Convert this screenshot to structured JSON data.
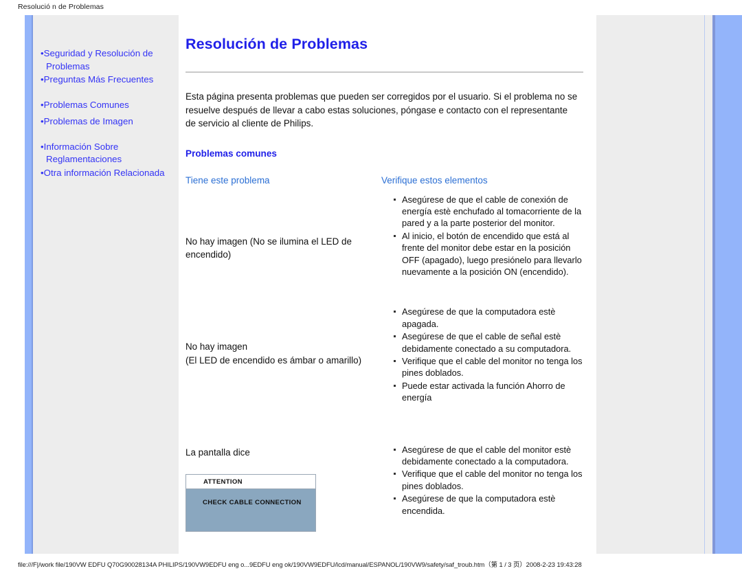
{
  "print_header": "Resolució n de Problemas",
  "sidebar": {
    "groups": [
      {
        "items": [
          {
            "label": "Seguridad y Resolución de Problemas"
          },
          {
            "label": "Preguntas Más Frecuentes"
          }
        ]
      },
      {
        "items": [
          {
            "label": "Problemas Comunes"
          },
          {
            "label": "Problemas de Imagen"
          }
        ]
      },
      {
        "items": [
          {
            "label": "Información Sobre Reglamentaciones"
          },
          {
            "label": "Otra información Relacionada"
          }
        ]
      }
    ]
  },
  "main": {
    "title": "Resolución de Problemas",
    "intro": "Esta página presenta problemas que pueden ser corregidos por el usuario. Si el problema no se resuelve después de llevar a cabo estas soluciones, póngase e contacto con el representante de servicio al cliente de Philips.",
    "section_heading": "Problemas comunes",
    "table": {
      "headers": [
        "Tiene este problema",
        "Verifique estos elementos"
      ],
      "rows": [
        {
          "problem": "No hay imagen (No se ilumina el LED de encendido)",
          "problem_extra": "",
          "checks": [
            "Asegúrese de que el cable de conexión de energía estè enchufado al tomacorriente de la pared y a la parte posterior del monitor.",
            "Al inicio, el botón de encendido que está al frente del monitor debe estar en la posición OFF (apagado), luego presiónelo para llevarlo nuevamente a la posición ON (encendido)."
          ]
        },
        {
          "problem": "No hay imagen",
          "problem_extra": "(El LED de encendido es ámbar o amarillo)",
          "checks": [
            "Asegúrese de que la computadora estè apagada.",
            "Asegúrese de que el cable de señal estè debidamente conectado a su computadora.",
            "Verifique que el cable del monitor no tenga los pines doblados.",
            "Puede estar activada la función Ahorro de energía"
          ]
        },
        {
          "problem": "La pantalla dice",
          "problem_extra": "",
          "checks": [
            "Asegúrese de que el cable del monitor estè debidamente conectado a la computadora.",
            "Verifique que el cable del monitor no tenga los pines doblados.",
            "Asegúrese de que la computadora estè encendida."
          ],
          "attention_box": {
            "title": "ATTENTION",
            "message": "CHECK CABLE CONNECTION"
          }
        }
      ]
    }
  },
  "footer": "file:///F|/work file/190VW EDFU Q70G90028134A PHILIPS/190VW9EDFU eng o...9EDFU eng ok/190VW9EDFU/lcd/manual/ESPANOL/190VW9/safety/saf_troub.htm（第 1 / 3 页）2008-2-23 19:43:28",
  "colors": {
    "link_blue": "#3333f5",
    "title_blue": "#1f1fe8",
    "header_blue": "#2b6fd4",
    "stripe_blue": "#93b4fa",
    "panel_gray": "#ededed",
    "attention_bg": "#8aa7bf"
  }
}
